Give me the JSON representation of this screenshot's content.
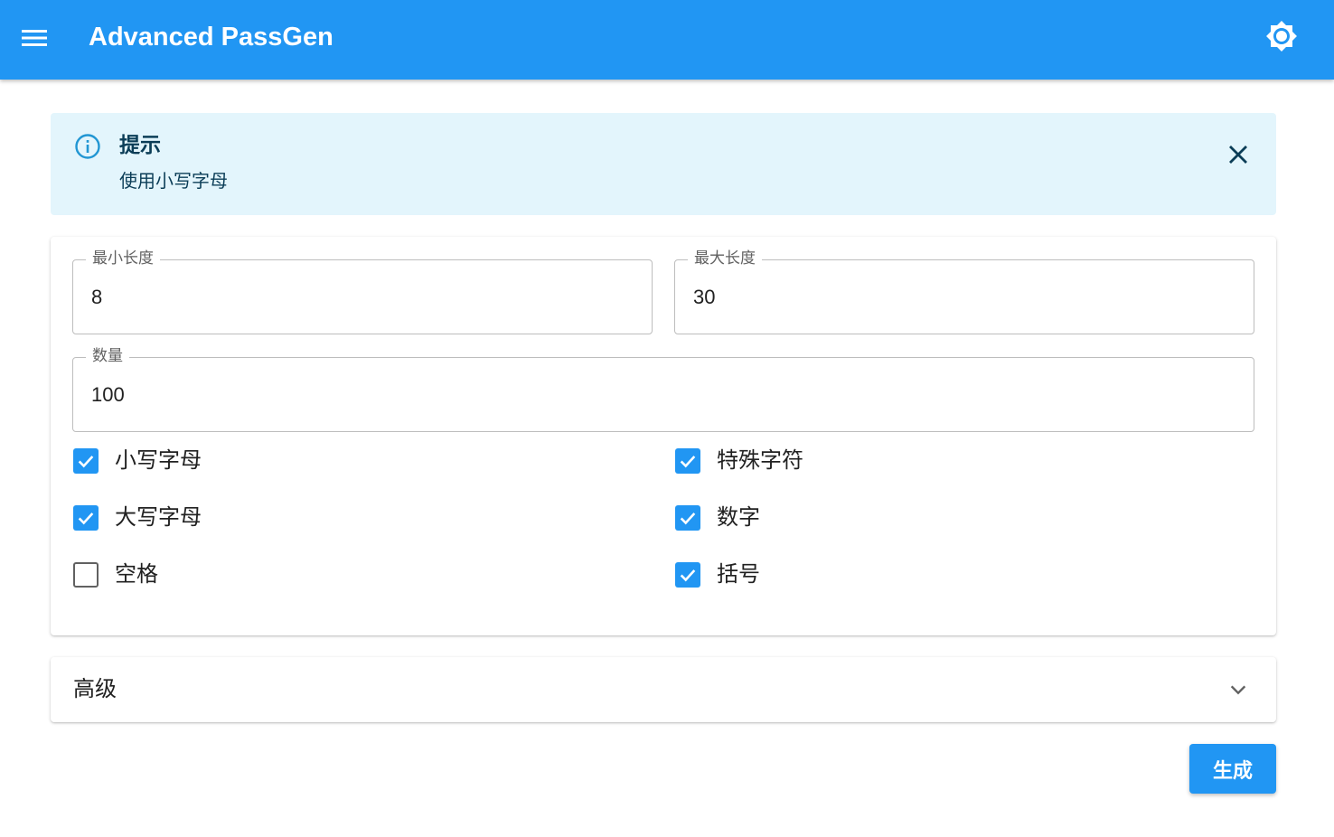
{
  "app": {
    "title": "Advanced PassGen",
    "menu_icon": "menu-icon",
    "theme_icon": "brightness-icon",
    "accent": "#2196f3"
  },
  "alert": {
    "icon": "info-icon",
    "title": "提示",
    "message": "使用小写字母",
    "close_icon": "close-icon",
    "background": "#e3f5fc"
  },
  "settings": {
    "min_length": {
      "label": "最小长度",
      "value": "8"
    },
    "max_length": {
      "label": "最大长度",
      "value": "30"
    },
    "count": {
      "label": "数量",
      "value": "100"
    },
    "options": [
      {
        "label": "小写字母",
        "checked": true
      },
      {
        "label": "特殊字符",
        "checked": true
      },
      {
        "label": "大写字母",
        "checked": true
      },
      {
        "label": "数字",
        "checked": true
      },
      {
        "label": "空格",
        "checked": false
      },
      {
        "label": "括号",
        "checked": true
      }
    ]
  },
  "advanced": {
    "title": "高级",
    "chevron_icon": "chevron-down-icon"
  },
  "actions": {
    "generate_label": "生成"
  }
}
